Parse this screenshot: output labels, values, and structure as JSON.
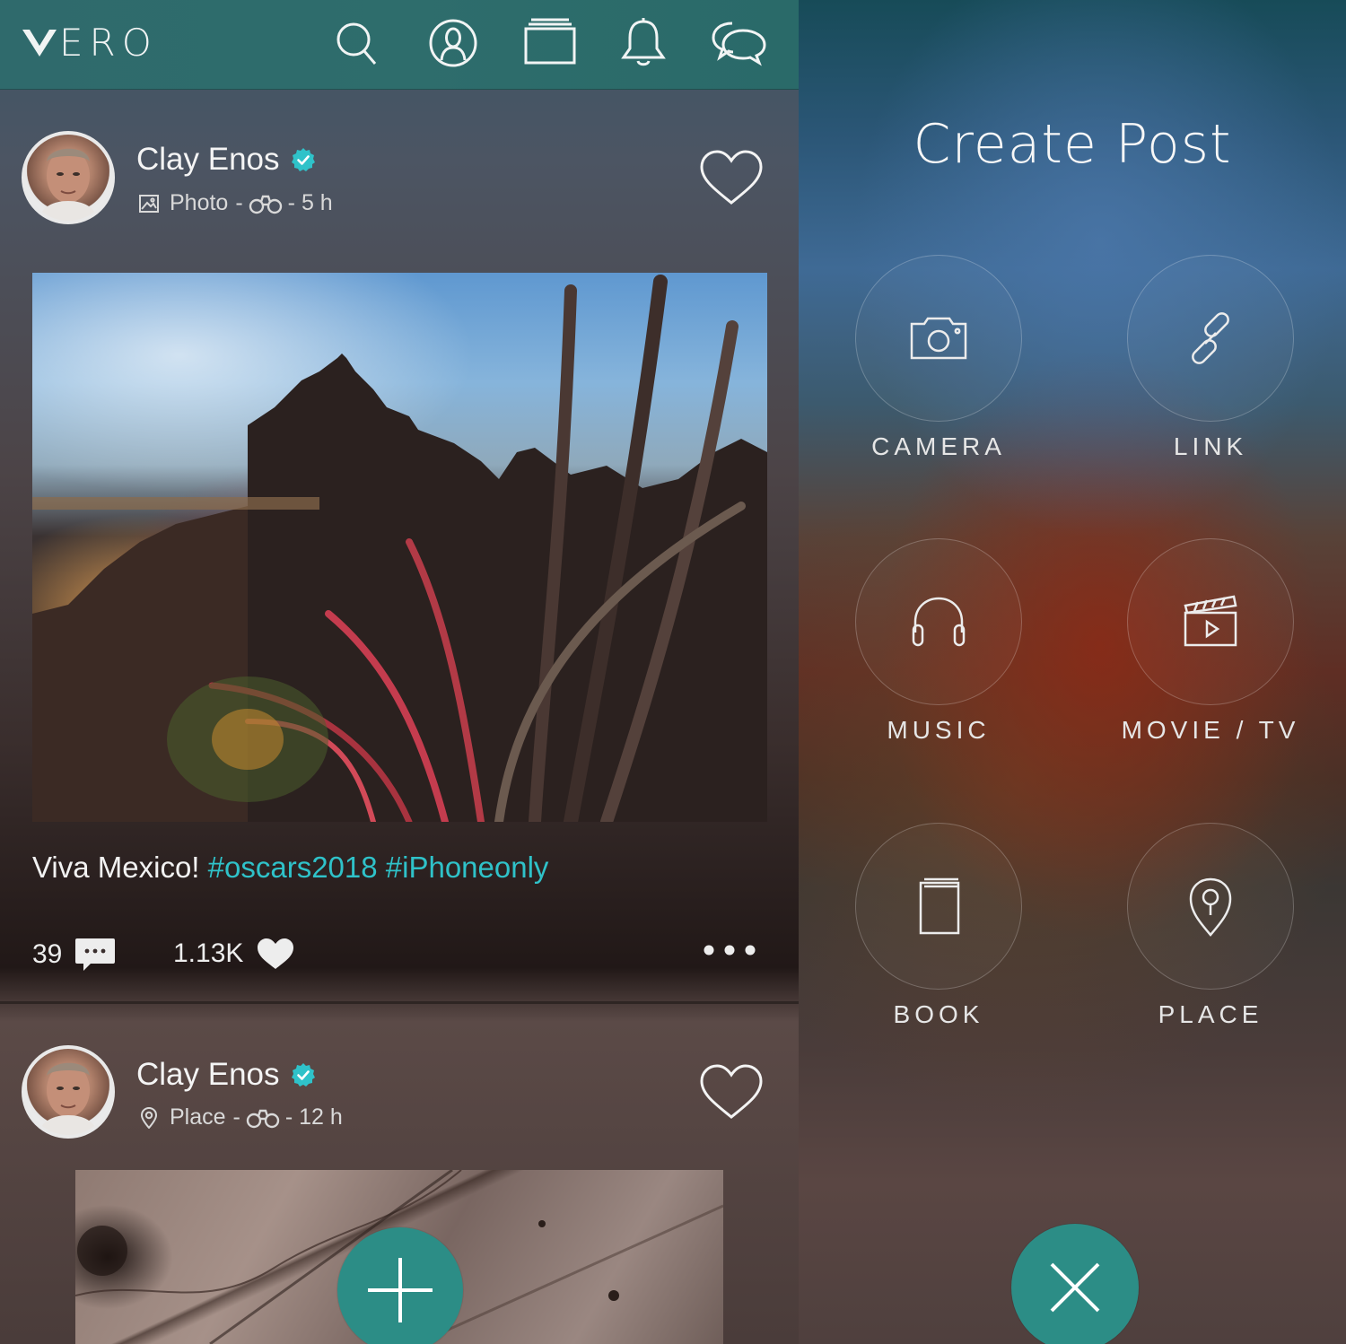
{
  "app": {
    "logo_text": "ERO"
  },
  "topbar": {
    "icons": [
      "search-icon",
      "profile-icon",
      "collections-icon",
      "bell-icon",
      "chat-icon"
    ]
  },
  "posts": [
    {
      "author": "Clay Enos",
      "type": "Photo",
      "separator": "-",
      "age": "- 5 h",
      "caption_text": "Viva Mexico!",
      "caption_tags": "#oscars2018 #iPhoneonly",
      "comments": "39",
      "likes": "1.13K"
    },
    {
      "author": "Clay Enos",
      "type": "Place",
      "separator": "-",
      "age": "- 12 h"
    }
  ],
  "create_post": {
    "title": "Create Post",
    "options": [
      {
        "label": "CAMERA",
        "icon": "camera-icon"
      },
      {
        "label": "LINK",
        "icon": "link-icon"
      },
      {
        "label": "MUSIC",
        "icon": "headphones-icon"
      },
      {
        "label": "MOVIE / TV",
        "icon": "clapperboard-icon"
      },
      {
        "label": "BOOK",
        "icon": "book-icon"
      },
      {
        "label": "PLACE",
        "icon": "location-pin-icon"
      }
    ]
  },
  "colors": {
    "accent": "#2fc2c9",
    "fab": "#2c8d86",
    "topbar": "#2f6a6c",
    "verified": "#2fc2c9"
  }
}
